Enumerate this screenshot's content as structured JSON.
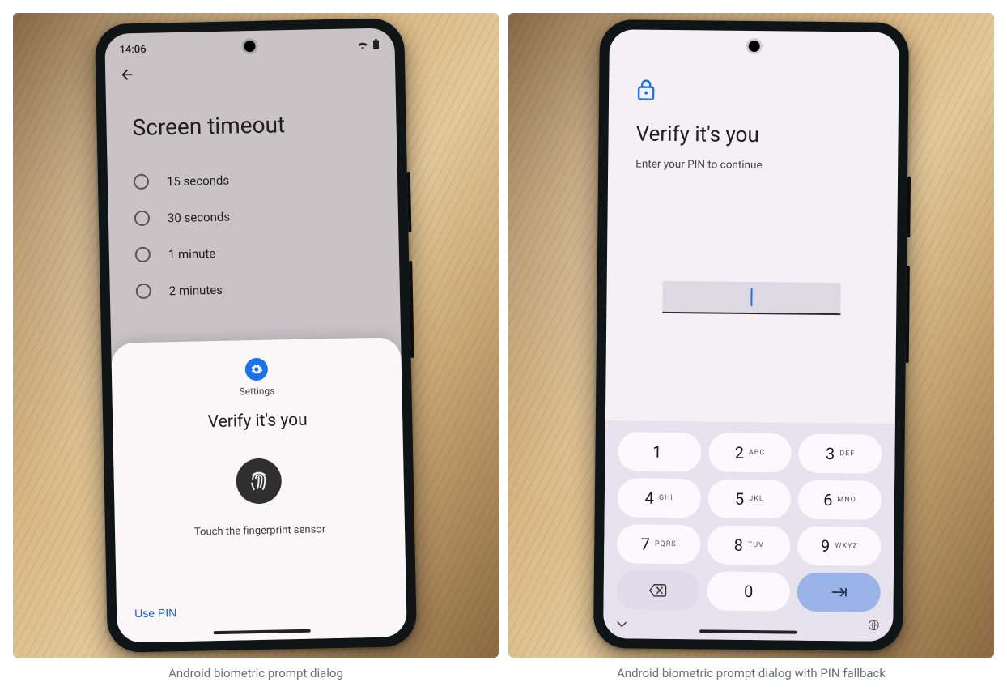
{
  "captions": {
    "left": "Android biometric prompt dialog",
    "right": "Android biometric prompt dialog with PIN fallback"
  },
  "left_phone": {
    "status": {
      "time": "14:06"
    },
    "settings": {
      "title": "Screen timeout",
      "options": [
        "15 seconds",
        "30 seconds",
        "1 minute",
        "2 minutes"
      ]
    },
    "sheet": {
      "app_name": "Settings",
      "title": "Verify it's you",
      "hint": "Touch the fingerprint sensor",
      "fallback_label": "Use PIN"
    }
  },
  "right_phone": {
    "verify": {
      "title": "Verify it's you",
      "subtitle": "Enter your PIN to continue"
    },
    "keypad": [
      {
        "digit": "1",
        "letters": ""
      },
      {
        "digit": "2",
        "letters": "ABC"
      },
      {
        "digit": "3",
        "letters": "DEF"
      },
      {
        "digit": "4",
        "letters": "GHI"
      },
      {
        "digit": "5",
        "letters": "JKL"
      },
      {
        "digit": "6",
        "letters": "MNO"
      },
      {
        "digit": "7",
        "letters": "PQRS"
      },
      {
        "digit": "8",
        "letters": "TUV"
      },
      {
        "digit": "9",
        "letters": "WXYZ"
      }
    ],
    "zero": "0"
  }
}
